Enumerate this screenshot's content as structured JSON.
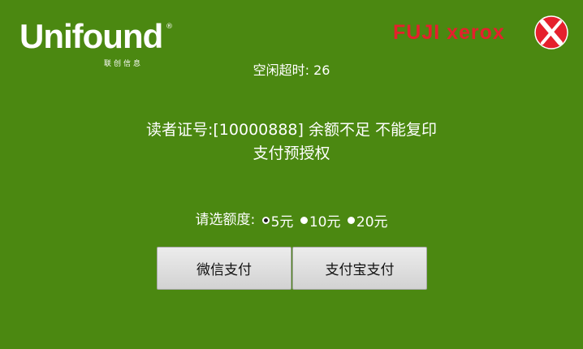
{
  "logos": {
    "left": {
      "brand": "Unifound",
      "registered": "®",
      "sub": "联创信息"
    },
    "right": {
      "brand": "FUJI xerox",
      "icon": "fuji-xerox-sphere-icon",
      "color": "#e5202d"
    }
  },
  "timeout": {
    "label": "空闲超时:",
    "value": "26"
  },
  "message": {
    "line1": "读者证号:[10000888] 余额不足 不能复印",
    "line2": "支付预授权"
  },
  "amount": {
    "label": "请选额度:",
    "options": [
      {
        "label": "5元",
        "selected": true
      },
      {
        "label": "10元",
        "selected": false
      },
      {
        "label": "20元",
        "selected": false
      }
    ]
  },
  "buttons": {
    "wechat": "微信支付",
    "alipay": "支付宝支付"
  },
  "colors": {
    "background": "#4b8811",
    "text": "#ffffff"
  }
}
